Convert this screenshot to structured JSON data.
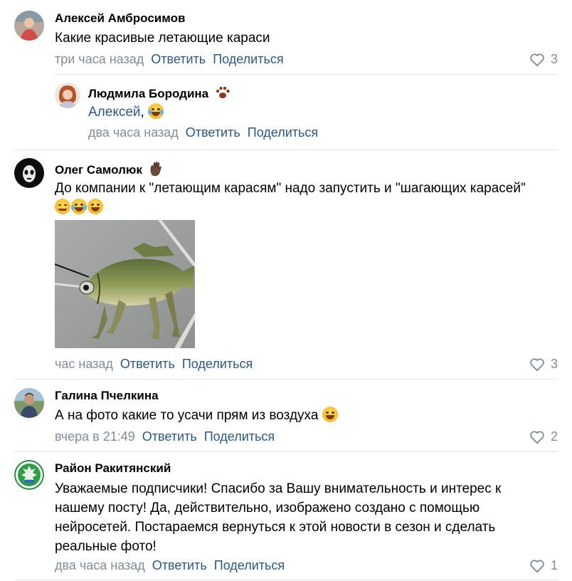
{
  "comments": [
    {
      "author": "Алексей Амбросимов",
      "text": "Какие красивые летающие караси",
      "time": "три часа назад",
      "reply": "Ответить",
      "share": "Поделиться",
      "likes": "3"
    },
    {
      "author": "Людмила Бородина",
      "mention": "Алексей",
      "separator": ",",
      "time": "два часа назад",
      "reply": "Ответить",
      "share": "Поделиться"
    },
    {
      "author": "Олег Самолюк",
      "text": "До компании к \"летающим карасям\" надо запустить и \"шагающих карасей\"",
      "time": "час назад",
      "reply": "Ответить",
      "share": "Поделиться",
      "likes": "3"
    },
    {
      "author": "Галина Пчелкина",
      "text": "А на фото какие то усачи прям из воздуха",
      "time": "вчера в 21:49",
      "reply": "Ответить",
      "share": "Поделиться",
      "likes": "2"
    },
    {
      "author": "Район Ракитянский",
      "text_lines": [
        "Уважаемые подписчики! Спасибо за Вашу внимательность и интерес к",
        "нашему посту! Да, действительно, изображено создано с помощью",
        "нейросетей. Постараемся вернуться к этой новости в сезон и сделать",
        "реальные фото!"
      ],
      "time": "два часа назад",
      "reply": "Ответить",
      "share": "Поделиться",
      "likes": "1"
    }
  ],
  "colors": {
    "link": "#2a5885",
    "meta": "#818c99",
    "divider": "#e7e8ec"
  },
  "icons": [
    "heart-icon",
    "paw-icon",
    "hand-icon",
    "laughing-emoji",
    "grinning-emoji",
    "relieved-emoji"
  ]
}
